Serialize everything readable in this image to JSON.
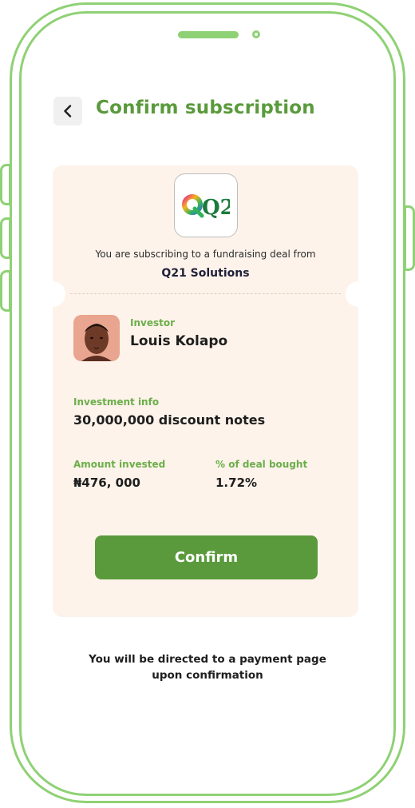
{
  "header": {
    "title": "Confirm subscription"
  },
  "deal": {
    "logo_text": "Q21",
    "intro_text": "You are subscribing to a fundraising deal from",
    "company_name": "Q21 Solutions"
  },
  "investor": {
    "label": "Investor",
    "name": "Louis Kolapo"
  },
  "investment": {
    "info_label": "Investment info",
    "info_value": "30,000,000 discount notes",
    "amount_label": "Amount invested",
    "amount_value": "₦476, 000",
    "percent_label": "% of deal bought",
    "percent_value": "1.72%"
  },
  "actions": {
    "confirm_label": "Confirm"
  },
  "footer": {
    "line1": "You will be directed to a payment page",
    "line2": "upon confirmation"
  },
  "colors": {
    "accent": "#5a9a3c",
    "label_green": "#6bae4a",
    "frame_green": "#8fd175",
    "card_bg": "#fdf3ea"
  }
}
